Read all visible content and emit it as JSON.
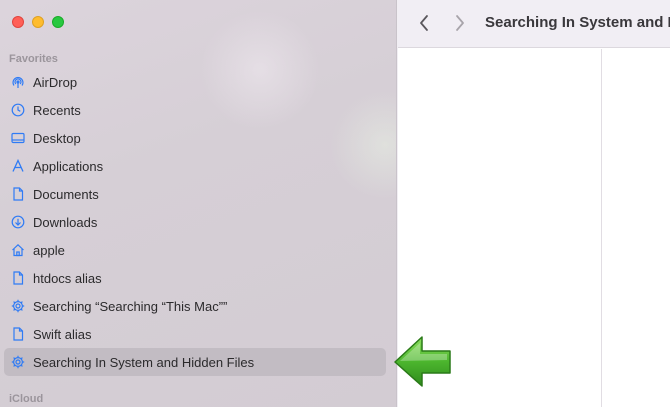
{
  "window": {
    "title": "Searching In System and Hidden Files"
  },
  "sidebar": {
    "favorites_label": "Favorites",
    "icloud_label": "iCloud",
    "items": [
      {
        "label": "AirDrop",
        "icon": "airdrop-icon"
      },
      {
        "label": "Recents",
        "icon": "clock-icon"
      },
      {
        "label": "Desktop",
        "icon": "desktop-icon"
      },
      {
        "label": "Applications",
        "icon": "applications-icon"
      },
      {
        "label": "Documents",
        "icon": "document-icon"
      },
      {
        "label": "Downloads",
        "icon": "download-icon"
      },
      {
        "label": "apple",
        "icon": "home-icon"
      },
      {
        "label": "htdocs alias",
        "icon": "document-icon"
      },
      {
        "label": "Searching “Searching “This Mac””",
        "icon": "gear-icon"
      },
      {
        "label": "Swift alias",
        "icon": "document-icon"
      },
      {
        "label": "Searching In System and Hidden Files",
        "icon": "gear-icon",
        "selected": true
      }
    ]
  },
  "colors": {
    "accent": "#2f7bf5",
    "selection": "#c2bcc3",
    "arrow": "#3fa32a"
  }
}
